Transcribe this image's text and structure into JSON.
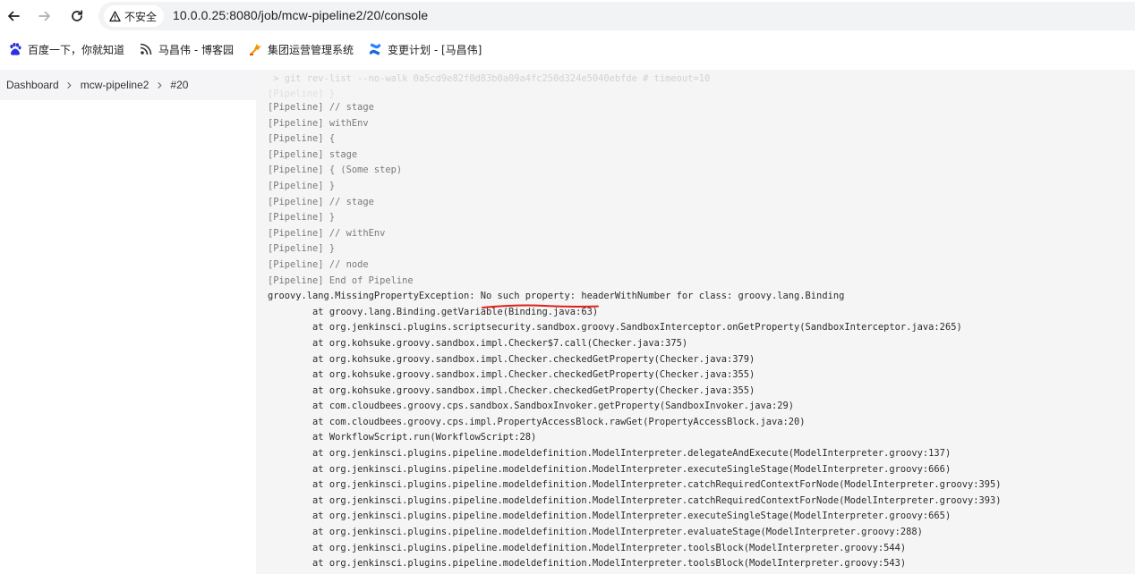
{
  "browser": {
    "security_label": "不安全",
    "url": "10.0.0.25:8080/job/mcw-pipeline2/20/console",
    "icons": [
      "back-arrow-icon",
      "forward-arrow-icon",
      "reload-icon",
      "warning-triangle-icon"
    ]
  },
  "bookmarks": [
    {
      "label": "百度一下，你就知道",
      "icon": "baidu-paw-icon"
    },
    {
      "label": "马昌伟 - 博客园",
      "icon": "cnblogs-icon"
    },
    {
      "label": "集团运营管理系统",
      "icon": "ops-system-icon"
    },
    {
      "label": "变更计划 - [马昌伟]",
      "icon": "confluence-icon"
    }
  ],
  "breadcrumb": [
    "Dashboard",
    "mcw-pipeline2",
    "#20"
  ],
  "console": {
    "faded_top": " > git rev-list --no-walk 0a5cd9e82f0d83b0a09a4fc250d324e5040ebfde # timeout=10",
    "faded_second": "[Pipeline] }",
    "lines": [
      {
        "kind": "pipe",
        "text": "[Pipeline] // stage"
      },
      {
        "kind": "pipe",
        "text": "[Pipeline] withEnv"
      },
      {
        "kind": "pipe",
        "text": "[Pipeline] {"
      },
      {
        "kind": "pipe",
        "text": "[Pipeline] stage"
      },
      {
        "kind": "pipe",
        "text": "[Pipeline] { (Some step)"
      },
      {
        "kind": "pipe",
        "text": "[Pipeline] }"
      },
      {
        "kind": "pipe",
        "text": "[Pipeline] // stage"
      },
      {
        "kind": "pipe",
        "text": "[Pipeline] }"
      },
      {
        "kind": "pipe",
        "text": "[Pipeline] // withEnv"
      },
      {
        "kind": "pipe",
        "text": "[Pipeline] }"
      },
      {
        "kind": "pipe",
        "text": "[Pipeline] // node"
      },
      {
        "kind": "pipe",
        "text": "[Pipeline] End of Pipeline"
      },
      {
        "kind": "err",
        "text": "groovy.lang.MissingPropertyException: No such property: headerWithNumber for class: groovy.lang.Binding"
      },
      {
        "kind": "trace",
        "text": "\tat groovy.lang.Binding.getVariable(Binding.java:63)"
      },
      {
        "kind": "trace",
        "text": "\tat org.jenkinsci.plugins.scriptsecurity.sandbox.groovy.SandboxInterceptor.onGetProperty(SandboxInterceptor.java:265)"
      },
      {
        "kind": "trace",
        "text": "\tat org.kohsuke.groovy.sandbox.impl.Checker$7.call(Checker.java:375)"
      },
      {
        "kind": "trace",
        "text": "\tat org.kohsuke.groovy.sandbox.impl.Checker.checkedGetProperty(Checker.java:379)"
      },
      {
        "kind": "trace",
        "text": "\tat org.kohsuke.groovy.sandbox.impl.Checker.checkedGetProperty(Checker.java:355)"
      },
      {
        "kind": "trace",
        "text": "\tat org.kohsuke.groovy.sandbox.impl.Checker.checkedGetProperty(Checker.java:355)"
      },
      {
        "kind": "trace",
        "text": "\tat com.cloudbees.groovy.cps.sandbox.SandboxInvoker.getProperty(SandboxInvoker.java:29)"
      },
      {
        "kind": "trace",
        "text": "\tat com.cloudbees.groovy.cps.impl.PropertyAccessBlock.rawGet(PropertyAccessBlock.java:20)"
      },
      {
        "kind": "trace",
        "text": "\tat WorkflowScript.run(WorkflowScript:28)"
      },
      {
        "kind": "trace",
        "text": "\tat org.jenkinsci.plugins.pipeline.modeldefinition.ModelInterpreter.delegateAndExecute(ModelInterpreter.groovy:137)"
      },
      {
        "kind": "trace",
        "text": "\tat org.jenkinsci.plugins.pipeline.modeldefinition.ModelInterpreter.executeSingleStage(ModelInterpreter.groovy:666)"
      },
      {
        "kind": "trace",
        "text": "\tat org.jenkinsci.plugins.pipeline.modeldefinition.ModelInterpreter.catchRequiredContextForNode(ModelInterpreter.groovy:395)"
      },
      {
        "kind": "trace",
        "text": "\tat org.jenkinsci.plugins.pipeline.modeldefinition.ModelInterpreter.catchRequiredContextForNode(ModelInterpreter.groovy:393)"
      },
      {
        "kind": "trace",
        "text": "\tat org.jenkinsci.plugins.pipeline.modeldefinition.ModelInterpreter.executeSingleStage(ModelInterpreter.groovy:665)"
      },
      {
        "kind": "trace",
        "text": "\tat org.jenkinsci.plugins.pipeline.modeldefinition.ModelInterpreter.evaluateStage(ModelInterpreter.groovy:288)"
      },
      {
        "kind": "trace",
        "text": "\tat org.jenkinsci.plugins.pipeline.modeldefinition.ModelInterpreter.toolsBlock(ModelInterpreter.groovy:544)"
      },
      {
        "kind": "trace",
        "text": "\tat org.jenkinsci.plugins.pipeline.modeldefinition.ModelInterpreter.toolsBlock(ModelInterpreter.groovy:543)"
      }
    ]
  },
  "colors": {
    "annotation_underline": "#e0201a",
    "console_bg": "#f5f5f5",
    "pipeline_text": "#7a7a7a",
    "trace_text": "#2b2b2b"
  }
}
